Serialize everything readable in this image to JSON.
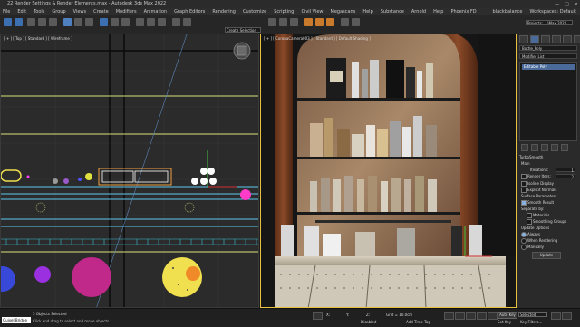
{
  "window": {
    "title": "22 Render Settings & Render Elements.max - Autodesk 3ds Max 2022",
    "controls": [
      "—",
      "□",
      "×"
    ]
  },
  "menu": {
    "items": [
      "File",
      "Edit",
      "Tools",
      "Group",
      "Views",
      "Create",
      "Modifiers",
      "Animation",
      "Graph Editors",
      "Rendering",
      "Customize",
      "Scripting",
      "Civil View",
      "Megascans",
      "Help",
      "Substance",
      "Arnold",
      "Help",
      "Phoenix FD"
    ],
    "user": "blackbalance",
    "workspace": "Workspaces: Default"
  },
  "toolbar": {
    "selection_set": "Create Selection Se",
    "viewport_mode": "View",
    "project": "Projects: ...\\Max 2022"
  },
  "viewports": {
    "left_label": "[ + ] [ Top ] [ Standard ] [ Wireframe ]",
    "right_label": "[ + ] [ CoronaCamera003 ] [ Standard ] [ Default Shading ]"
  },
  "command_panel": {
    "object_name": "Bottle_Poly",
    "modifier_list_label": "Modifier List",
    "stack_item": "Editable Poly",
    "rollout_title": "TurboSmooth",
    "main_label": "Main",
    "iterations_label": "Iterations:",
    "iterations_value": "1",
    "render_iters_label": "Render Iters:",
    "render_iters_value": "2",
    "isoline_label": "Isoline Display",
    "explicit_normals_label": "Explicit Normals",
    "surface_params_label": "Surface Parameters",
    "smooth_result_label": "Smooth Result",
    "separate_by_label": "Separate by:",
    "materials_label": "Materials",
    "smoothing_groups_label": "Smoothing Groups",
    "update_options_label": "Update Options",
    "always_label": "Always",
    "when_rendering_label": "When Rendering",
    "manually_label": "Manually",
    "update_button": "Update"
  },
  "status": {
    "maxscript": "Quixel Bridge",
    "selected": "5 Objects Selected",
    "hint": "Click and drag to select and move objects",
    "x": "X:",
    "y": "Y:",
    "z": "Z:",
    "grid": "Grid = 10.0cm",
    "add_time_tag": "Add Time Tag",
    "enabled": "Disabled",
    "auto": "Auto Key",
    "selected_dropdown": "Selected",
    "set_key": "Set Key",
    "key_filters": "Key Filters..."
  }
}
